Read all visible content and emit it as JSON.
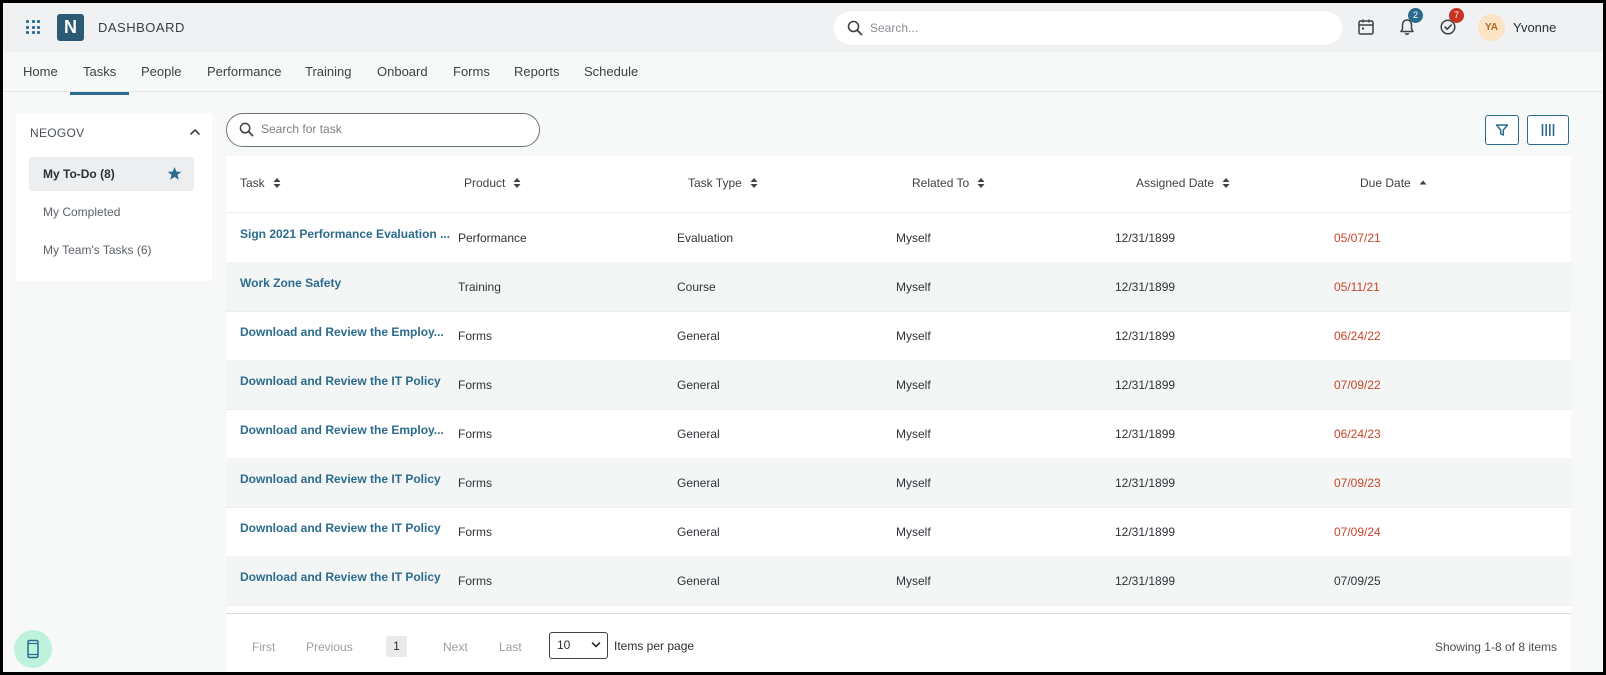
{
  "header": {
    "title": "DASHBOARD",
    "logo_letter": "N",
    "search_placeholder": "Search...",
    "notifications_count": "2",
    "tasks_count": "7",
    "user_initials": "YA",
    "user_name": "Yvonne"
  },
  "nav": {
    "tabs": [
      "Home",
      "Tasks",
      "People",
      "Performance",
      "Training",
      "Onboard",
      "Forms",
      "Reports",
      "Schedule"
    ],
    "active": "Tasks"
  },
  "sidebar": {
    "header": "NEOGOV",
    "items": [
      {
        "label": "My To-Do (8)",
        "active": true
      },
      {
        "label": "My Completed",
        "active": false
      },
      {
        "label": "My Team's Tasks (6)",
        "active": false
      }
    ]
  },
  "task_search": {
    "placeholder": "Search for task"
  },
  "table": {
    "columns": [
      "Task",
      "Product",
      "Task Type",
      "Related To",
      "Assigned Date",
      "Due Date"
    ],
    "rows": [
      {
        "task": "Sign 2021 Performance Evaluation ...",
        "product": "Performance",
        "type": "Evaluation",
        "related": "Myself",
        "assigned": "12/31/1899",
        "due": "05/07/21",
        "overdue": true
      },
      {
        "task": "Work Zone Safety",
        "product": "Training",
        "type": "Course",
        "related": "Myself",
        "assigned": "12/31/1899",
        "due": "05/11/21",
        "overdue": true
      },
      {
        "task": "Download and Review the Employ...",
        "product": "Forms",
        "type": "General",
        "related": "Myself",
        "assigned": "12/31/1899",
        "due": "06/24/22",
        "overdue": true
      },
      {
        "task": "Download and Review the IT Policy",
        "product": "Forms",
        "type": "General",
        "related": "Myself",
        "assigned": "12/31/1899",
        "due": "07/09/22",
        "overdue": true
      },
      {
        "task": "Download and Review the Employ...",
        "product": "Forms",
        "type": "General",
        "related": "Myself",
        "assigned": "12/31/1899",
        "due": "06/24/23",
        "overdue": true
      },
      {
        "task": "Download and Review the IT Policy",
        "product": "Forms",
        "type": "General",
        "related": "Myself",
        "assigned": "12/31/1899",
        "due": "07/09/23",
        "overdue": true
      },
      {
        "task": "Download and Review the IT Policy",
        "product": "Forms",
        "type": "General",
        "related": "Myself",
        "assigned": "12/31/1899",
        "due": "07/09/24",
        "overdue": true
      },
      {
        "task": "Download and Review the IT Policy",
        "product": "Forms",
        "type": "General",
        "related": "Myself",
        "assigned": "12/31/1899",
        "due": "07/09/25",
        "overdue": false
      }
    ]
  },
  "pager": {
    "first": "First",
    "previous": "Previous",
    "current": "1",
    "next": "Next",
    "last": "Last",
    "per_page": "10",
    "per_page_label": "Items per page",
    "showing": "Showing 1-8 of 8 items"
  },
  "colors": {
    "accent": "#2b6c8e",
    "overdue": "#c8452b",
    "badge_blue": "#2b6c8e",
    "badge_red": "#c7311f"
  },
  "icons": [
    "apps-grid-icon",
    "search-icon",
    "calendar-icon",
    "bell-icon",
    "check-circle-icon",
    "chevron-up-icon",
    "star-icon",
    "filter-icon",
    "columns-icon",
    "sort-icon",
    "mobile-icon"
  ]
}
